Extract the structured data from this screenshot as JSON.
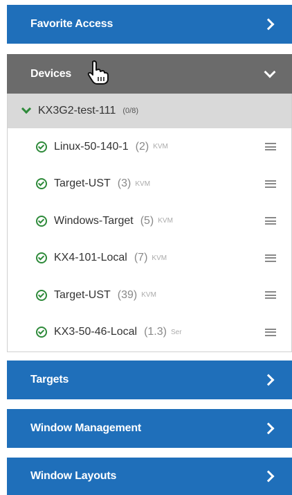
{
  "sections": {
    "favorite_access": {
      "label": "Favorite Access"
    },
    "devices": {
      "label": "Devices"
    },
    "targets": {
      "label": "Targets"
    },
    "window_management": {
      "label": "Window Management"
    },
    "window_layouts": {
      "label": "Window Layouts"
    }
  },
  "device_group": {
    "name": "KX3G2-test-111",
    "count": "(0/8)"
  },
  "devices": [
    {
      "name": "Linux-50-140-1",
      "port": "(2)",
      "type": "KVM"
    },
    {
      "name": "Target-UST",
      "port": "(3)",
      "type": "KVM"
    },
    {
      "name": "Windows-Target",
      "port": "(5)",
      "type": "KVM"
    },
    {
      "name": "KX4-101-Local",
      "port": "(7)",
      "type": "KVM"
    },
    {
      "name": "Target-UST",
      "port": "(39)",
      "type": "KVM"
    },
    {
      "name": "KX3-50-46-Local",
      "port": "(1.3)",
      "type": "Ser"
    }
  ],
  "icons": {
    "section_collapsed": "chevron-right-icon",
    "section_expanded": "chevron-down-icon",
    "device_status": "check-circle-icon",
    "device_menu": "hamburger-menu-icon",
    "cursor": "hand-pointer-icon"
  },
  "colors": {
    "section_header": "#1f6fba",
    "active_section_header": "#6b6b6b",
    "group_header": "#d9d9d9",
    "status_ok": "#2e8a3a"
  }
}
